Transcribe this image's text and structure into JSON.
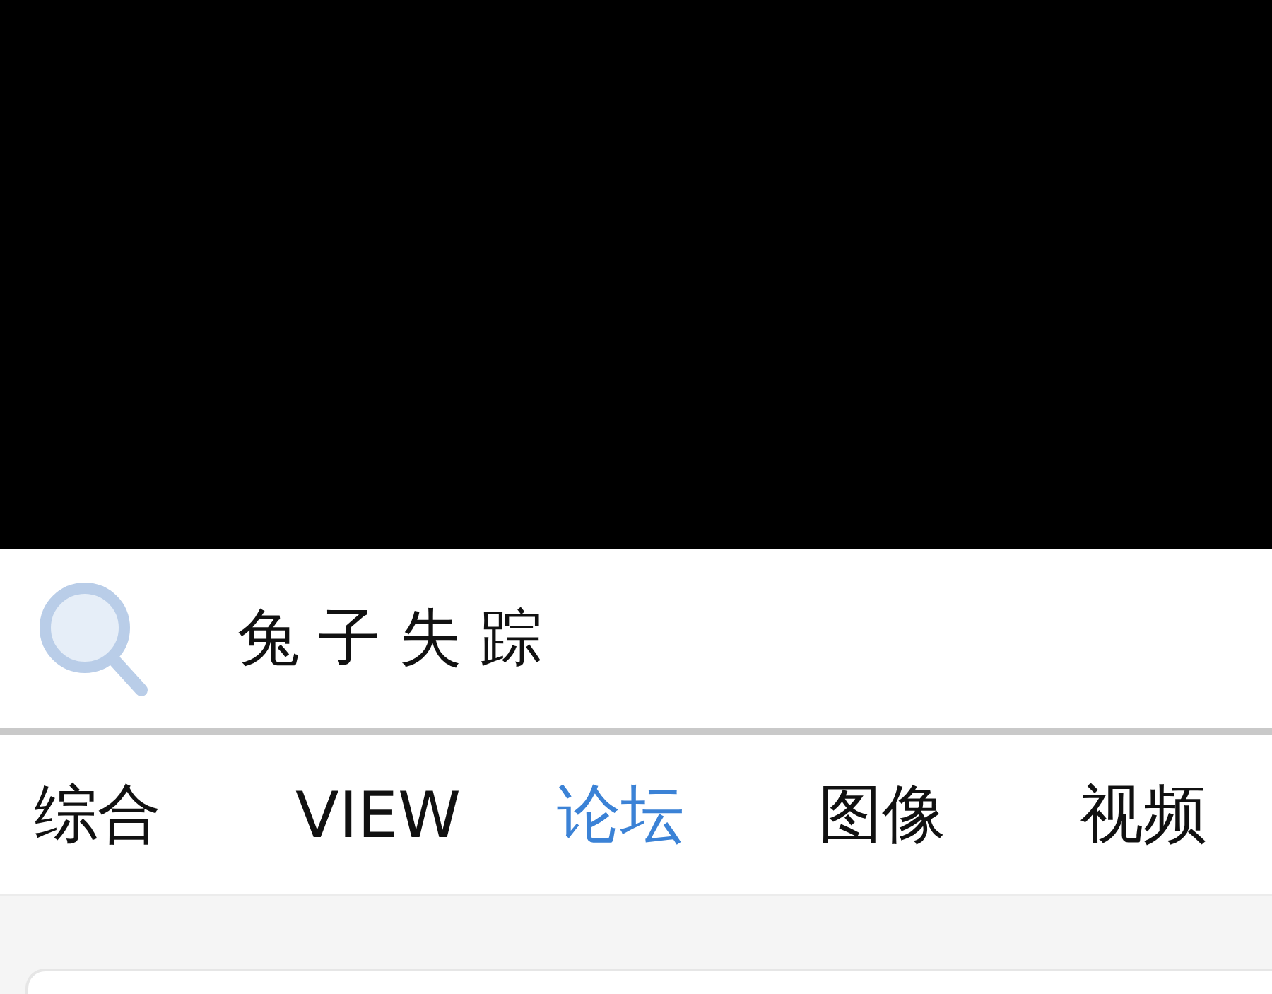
{
  "search": {
    "value": "兔子失踪"
  },
  "tabs": [
    {
      "label": "综合",
      "selected": false
    },
    {
      "label": "VIEW",
      "selected": false
    },
    {
      "label": "论坛",
      "selected": true
    },
    {
      "label": "图像",
      "selected": false
    },
    {
      "label": "视频",
      "selected": false
    }
  ]
}
